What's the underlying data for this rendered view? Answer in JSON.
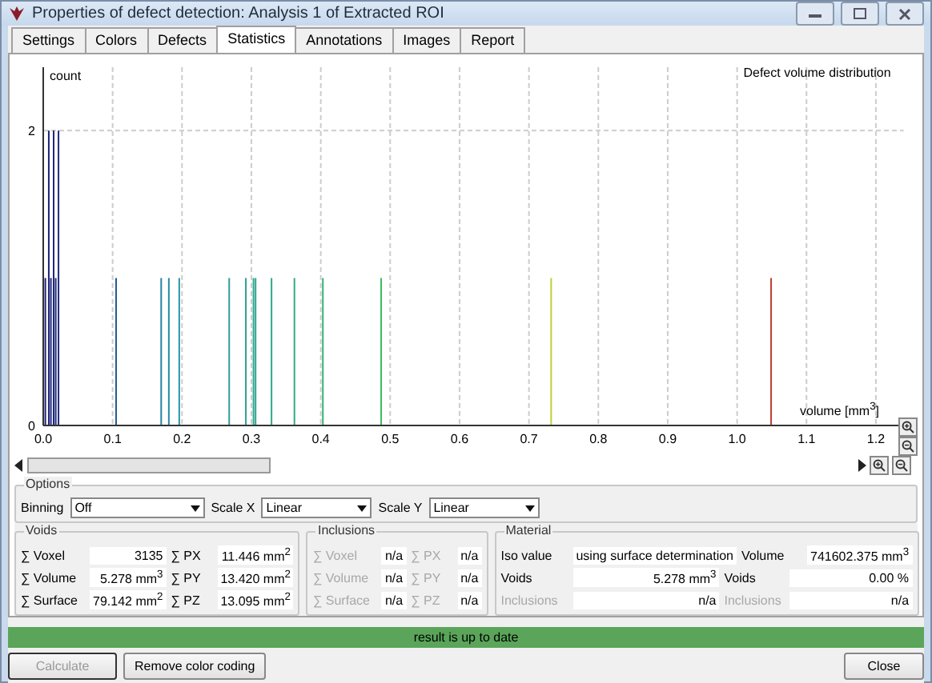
{
  "window": {
    "title": "Properties of defect detection: Analysis 1 of Extracted ROI"
  },
  "tabs": [
    {
      "label": "Settings",
      "selected": false
    },
    {
      "label": "Colors",
      "selected": false
    },
    {
      "label": "Defects",
      "selected": false
    },
    {
      "label": "Statistics",
      "selected": true
    },
    {
      "label": "Annotations",
      "selected": false
    },
    {
      "label": "Images",
      "selected": false
    },
    {
      "label": "Report",
      "selected": false
    }
  ],
  "chart": {
    "chart_data": {
      "type": "bar",
      "title": "Defect volume distribution",
      "xlabel": "volume [mm$^{3}$]",
      "ylabel": "count",
      "xlim": [
        0,
        1.24
      ],
      "ylim": [
        0,
        2.43
      ],
      "xticks": [
        {
          "value": 0,
          "label": "0.0"
        },
        {
          "value": 0.1,
          "label": "0.1"
        },
        {
          "value": 0.2,
          "label": "0.2"
        },
        {
          "value": 0.3,
          "label": "0.3"
        },
        {
          "value": 0.4,
          "label": "0.4"
        },
        {
          "value": 0.5,
          "label": "0.5"
        },
        {
          "value": 0.6,
          "label": "0.6"
        },
        {
          "value": 0.7,
          "label": "0.7"
        },
        {
          "value": 0.8,
          "label": "0.8"
        },
        {
          "value": 0.9,
          "label": "0.9"
        },
        {
          "value": 1.0,
          "label": "1.0"
        },
        {
          "value": 1.1,
          "label": "1.1"
        },
        {
          "value": 1.2,
          "label": "1.2"
        }
      ],
      "yticks": [
        0,
        2
      ],
      "x": [
        0.003,
        0.008,
        0.011,
        0.015,
        0.018,
        0.022,
        0.105,
        0.17,
        0.181,
        0.196,
        0.268,
        0.292,
        0.303,
        0.306,
        0.329,
        0.362,
        0.403,
        0.487,
        0.732,
        1.049
      ],
      "grid": true,
      "series": [
        {
          "values": [
            1,
            2,
            1,
            2,
            1,
            2,
            1,
            1,
            1,
            1,
            1,
            1,
            1,
            1,
            1,
            1,
            1,
            1,
            1,
            1
          ]
        }
      ]
    }
  },
  "options": {
    "title": "Options",
    "fields": [
      {
        "label": "Binning",
        "value": "Off"
      },
      {
        "label": "Scale X",
        "value": "Linear"
      },
      {
        "label": "Scale Y",
        "value": "Linear"
      }
    ]
  },
  "groups": [
    {
      "title": "Voids",
      "rows": [
        {
          "label": "∑ Voxel",
          "value": "3135",
          "label2": "∑ PX",
          "value2": "11.446 mm$^{2}$",
          "disabled": false
        },
        {
          "label": "∑ Volume",
          "value": "5.278 mm$^{3}$",
          "label2": "∑ PY",
          "value2": "13.420 mm$^{2}$",
          "disabled": false
        },
        {
          "label": "∑ Surface",
          "value": "79.142 mm$^{2}$",
          "label2": "∑ PZ",
          "value2": "13.095 mm$^{2}$",
          "disabled": false
        }
      ]
    },
    {
      "title": "Inclusions",
      "rows": [
        {
          "label": "∑ Voxel",
          "value": "n/a",
          "label2": "∑ PX",
          "value2": "n/a",
          "disabled": true
        },
        {
          "label": "∑ Volume",
          "value": "n/a",
          "label2": "∑ PY",
          "value2": "n/a",
          "disabled": true
        },
        {
          "label": "∑ Surface",
          "value": "n/a",
          "label2": "∑ PZ",
          "value2": "n/a",
          "disabled": true
        }
      ]
    },
    {
      "title": "Material",
      "rows": [
        {
          "label": "Iso value",
          "value": "using surface determination",
          "label2": "Volume",
          "value2": "741602.375 mm$^{3}$",
          "disabled": false
        },
        {
          "label": "Voids",
          "value": "5.278 mm$^{3}$",
          "label2": "Voids",
          "value2": "0.00 %",
          "disabled": false
        },
        {
          "label": "Inclusions",
          "value": "n/a",
          "label2": "Inclusions",
          "value2": "n/a",
          "disabled": true
        }
      ]
    }
  ],
  "status_bar": {
    "text": "result is up to date"
  },
  "buttons": [
    {
      "label": "Calculate",
      "disabled": true
    },
    {
      "label": "Remove color coding",
      "disabled": false
    },
    {
      "label": "Close",
      "disabled": false
    }
  ]
}
